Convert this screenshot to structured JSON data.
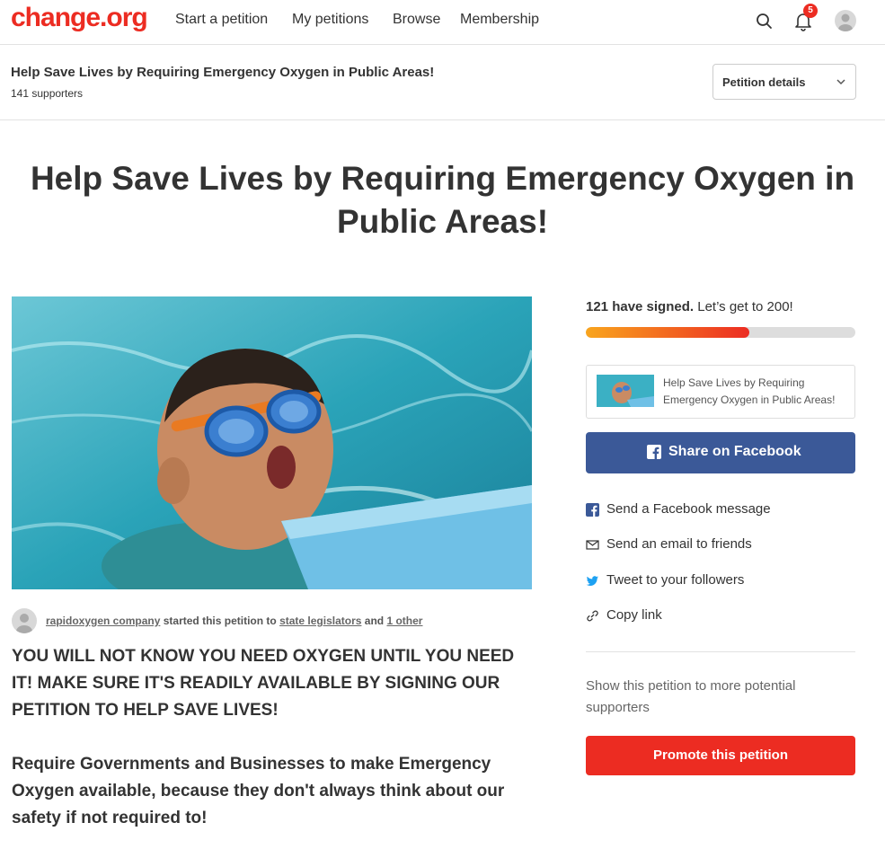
{
  "nav": {
    "logo": "change.org",
    "links": [
      "Start a petition",
      "My petitions",
      "Browse",
      "Membership"
    ],
    "notification_count": "5",
    "icons": [
      "search-icon",
      "bell-icon",
      "user-avatar"
    ]
  },
  "sticky": {
    "title": "Help Save Lives by Requiring Emergency Oxygen in Public Areas!",
    "supporters": "141 supporters",
    "details_label": "Petition details"
  },
  "petition": {
    "title": "Help Save Lives by Requiring Emergency Oxygen in Public Areas!",
    "starter_name": "rapidoxygen company",
    "starter_mid": "started this petition to",
    "target": "state legislators",
    "and": "and",
    "other": "1 other",
    "body1": "YOU WILL NOT KNOW YOU NEED OXYGEN UNTIL YOU NEED IT! MAKE SURE IT'S READILY AVAILABLE BY SIGNING OUR PETITION TO HELP SAVE LIVES!",
    "body2": "Require Governments and Businesses to make Emergency Oxygen available, because they don't always think about our safety if not required to!"
  },
  "sidebar": {
    "signed_bold": "121 have signed.",
    "signed_rest": "Let’s get to 200!",
    "signed_count": 121,
    "goal": 200,
    "preview_text": "Help Save Lives by Requiring Emergency Oxygen in Public Areas!",
    "facebook_button": "Share on Facebook",
    "share_options": [
      {
        "label": "Send a Facebook message",
        "icon": "facebook-icon"
      },
      {
        "label": "Send an email to friends",
        "icon": "email-icon"
      },
      {
        "label": "Tweet to your followers",
        "icon": "twitter-icon"
      },
      {
        "label": "Copy link",
        "icon": "link-icon"
      }
    ],
    "promote_text": "Show this petition to more potential supporters",
    "promote_button": "Promote this petition"
  },
  "colors": {
    "brand_red": "#ec2c22",
    "facebook_blue": "#3b5998",
    "progress_start": "#f9a51e"
  }
}
